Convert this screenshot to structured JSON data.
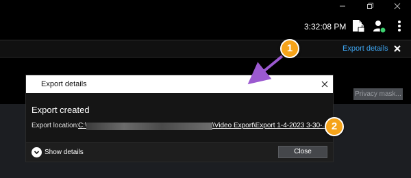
{
  "window": {
    "controls": [
      "minimize-icon",
      "restore-icon",
      "close-icon"
    ]
  },
  "topbar": {
    "clock": "3:32:08 PM",
    "icons": [
      "document-lock-icon",
      "user-status-icon",
      "more-vertical-icon"
    ],
    "status_color": "#3bd16f"
  },
  "notification": {
    "link_label": "Export details",
    "link_color": "#3ea6f2"
  },
  "workspace": {
    "privacy_mask_label": "Privacy mask..."
  },
  "dialog": {
    "title": "Export details",
    "heading": "Export created",
    "location_label": "Export location:",
    "location_start": "C:\\",
    "location_end": "\\Video Export\\Export 1-4-2023 3-30-...",
    "show_details_label": "Show details",
    "close_label": "Close"
  },
  "callouts": {
    "marker_1": "1",
    "marker_2": "2",
    "marker_color": "#f5a31a",
    "arrow_color": "#9b59d0"
  }
}
